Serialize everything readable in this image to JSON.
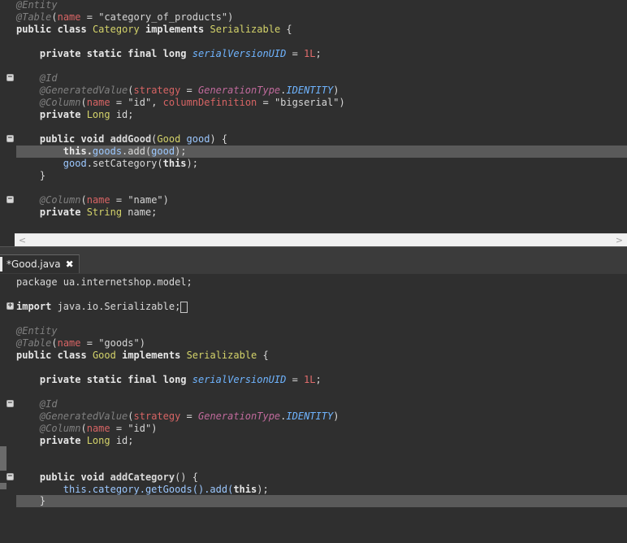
{
  "editor_top": {
    "lines": [
      [
        "@Entity"
      ],
      [
        "@Table",
        "(",
        "name",
        " = ",
        "\"category_of_products\"",
        ")"
      ],
      [
        "public",
        " ",
        "class",
        " ",
        "Category",
        " ",
        "implements",
        " ",
        "Serializable",
        " {"
      ],
      [
        "    private static final long ",
        "serialVersionUID",
        " = ",
        "1L",
        ";"
      ],
      [
        "    @Id"
      ],
      [
        "    @GeneratedValue",
        "(",
        "strategy",
        " = ",
        "GenerationType",
        ".",
        "IDENTITY",
        ")"
      ],
      [
        "    @Column",
        "(",
        "name",
        " = ",
        "\"id\"",
        ", ",
        "columnDefinition",
        " = ",
        "\"bigserial\"",
        ")"
      ],
      [
        "    private ",
        "Long",
        " id;"
      ],
      [
        "    public void ",
        "addGood",
        "(",
        "Good",
        " ",
        "good",
        ") {"
      ],
      [
        "        this.",
        "goods",
        ".add(",
        "good",
        ");"
      ],
      [
        "        ",
        "good",
        ".setCategory(",
        "this",
        ");"
      ],
      [
        "    }"
      ],
      [
        "    @Column",
        "(",
        "name",
        " = ",
        "\"name\"",
        ")"
      ],
      [
        "    private ",
        "String",
        " name;"
      ]
    ]
  },
  "tab": {
    "label": "*Good.java",
    "close": "✖"
  },
  "editor_bottom": {
    "lines": [
      [
        "package ua.internetshop.model;"
      ],
      [
        "import ",
        "java.io.Serializable;"
      ],
      [
        "@Entity"
      ],
      [
        "@Table",
        "(",
        "name",
        " = ",
        "\"goods\"",
        ")"
      ],
      [
        "public",
        " ",
        "class",
        " ",
        "Good",
        " ",
        "implements",
        " ",
        "Serializable",
        " {"
      ],
      [
        "    private static final long ",
        "serialVersionUID",
        " = ",
        "1L",
        ";"
      ],
      [
        "    @Id"
      ],
      [
        "    @GeneratedValue",
        "(",
        "strategy",
        " = ",
        "GenerationType",
        ".",
        "IDENTITY",
        ")"
      ],
      [
        "    @Column",
        "(",
        "name",
        " = ",
        "\"id\"",
        ")"
      ],
      [
        "    private ",
        "Long",
        " id;"
      ],
      [
        "    public void ",
        "addCategory",
        "() {"
      ],
      [
        "        this.category.getGoods().add(",
        "this",
        ");"
      ],
      [
        "    }"
      ]
    ]
  },
  "scrollbar": {
    "left_arrow": "<",
    "right_arrow": ">"
  }
}
